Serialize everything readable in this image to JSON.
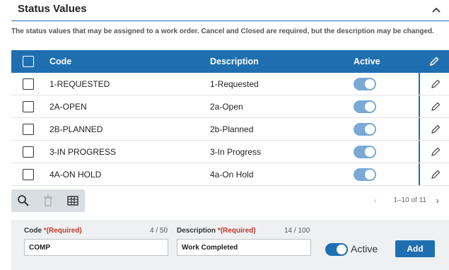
{
  "section": {
    "title": "Status Values",
    "description": "The status values that may be assigned to a work order. Cancel and Closed are required, but the description may be changed."
  },
  "grid": {
    "columns": {
      "code": "Code",
      "description": "Description",
      "active": "Active"
    },
    "rows": [
      {
        "code": "1-REQUESTED",
        "description": "1-Requested",
        "active": true
      },
      {
        "code": "2A-OPEN",
        "description": "2a-Open",
        "active": true
      },
      {
        "code": "2B-PLANNED",
        "description": "2b-Planned",
        "active": true
      },
      {
        "code": "3-IN PROGRESS",
        "description": "3-In Progress",
        "active": true
      },
      {
        "code": "4A-ON HOLD",
        "description": "4a-On Hold",
        "active": true
      }
    ]
  },
  "pager": {
    "label": "1–10 of 11"
  },
  "form": {
    "code_label": "Code",
    "code_required": "*(Required)",
    "code_counter": "4 / 50",
    "code_value": "COMP",
    "description_label": "Description",
    "description_required": "*(Required)",
    "description_counter": "14 / 100",
    "description_value": "Work Completed",
    "active_label": "Active",
    "add_label": "Add"
  },
  "colors": {
    "accent": "#1f6fb0",
    "toggle_on": "#7aa9d6",
    "required": "#c0392b"
  }
}
